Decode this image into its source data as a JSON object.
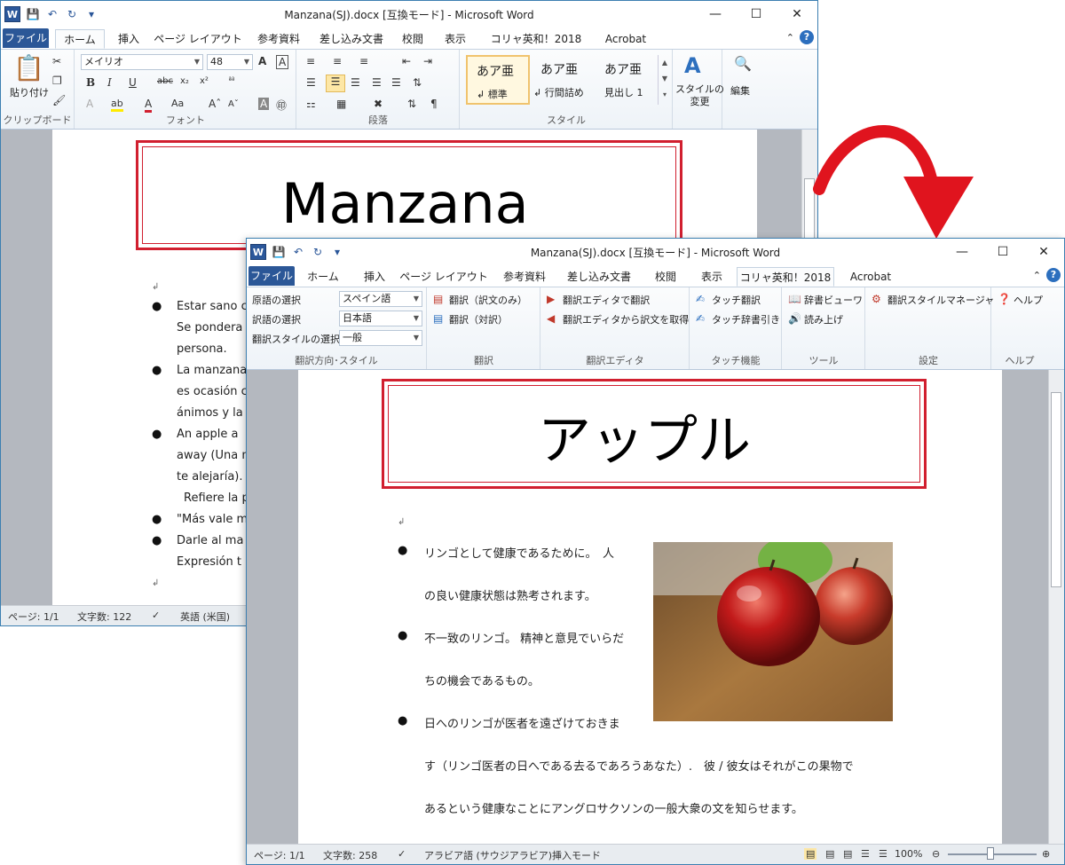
{
  "back_window": {
    "title": "Manzana(SJ).docx [互換モード] - Microsoft Word",
    "tabs": [
      "ファイル",
      "ホーム",
      "挿入",
      "ページ レイアウト",
      "参考資料",
      "差し込み文書",
      "校閲",
      "表示",
      "コリャ英和！2018",
      "Acrobat"
    ],
    "ribbon": {
      "clipboard": {
        "paste": "貼り付け",
        "label": "クリップボード"
      },
      "font": {
        "name": "メイリオ",
        "size": "48",
        "label": "フォント"
      },
      "paragraph": {
        "label": "段落"
      },
      "styles": {
        "items": [
          {
            "sample": "あア亜",
            "name": "↲ 標準"
          },
          {
            "sample": "あア亜",
            "name": "↲ 行間詰め"
          },
          {
            "sample": "あア亜",
            "name": "見出し 1"
          }
        ],
        "change": "スタイルの\n変更",
        "label": "スタイル"
      },
      "edit": {
        "label": "編集"
      }
    },
    "doc": {
      "heading": "Manzana",
      "lines": [
        "Estar sano c",
        "Se pondera",
        "persona.",
        "La manzana",
        "es ocasión c",
        "ánimos y la",
        "An apple a",
        "away (Una m",
        "te alejaría).",
        "Refiere la p",
        "\"Más vale m",
        "Darle al ma",
        "Expresión t"
      ]
    },
    "status": {
      "page": "ページ: 1/1",
      "words": "文字数: 122",
      "lang": "英語 (米国)"
    }
  },
  "front_window": {
    "title": "Manzana(SJ).docx [互換モード] - Microsoft Word",
    "tabs": [
      "ファイル",
      "ホーム",
      "挿入",
      "ページ レイアウト",
      "参考資料",
      "差し込み文書",
      "校閲",
      "表示",
      "コリャ英和！2018",
      "Acrobat"
    ],
    "ribbon": {
      "direction": {
        "source_label": "原語の選択",
        "source_value": "スペイン語",
        "target_label": "訳語の選択",
        "target_value": "日本語",
        "style_label": "翻訳スタイルの選択",
        "style_value": "一般",
        "label": "翻訳方向･スタイル"
      },
      "translate": {
        "only": "翻訳（訳文のみ）",
        "pair": "翻訳（対訳）",
        "label": "翻訳"
      },
      "editor": {
        "translate": "翻訳エディタで翻訳",
        "get": "翻訳エディタから訳文を取得",
        "label": "翻訳エディタ"
      },
      "touch": {
        "translate": "タッチ翻訳",
        "dict": "タッチ辞書引き",
        "label": "タッチ機能"
      },
      "tools": {
        "viewer": "辞書ビューワ",
        "read": "読み上げ",
        "label": "ツール"
      },
      "settings": {
        "manager": "翻訳スタイルマネージャ",
        "label": "設定"
      },
      "help": {
        "help": "ヘルプ",
        "label": "ヘルプ"
      }
    },
    "doc": {
      "heading": "アップル",
      "b1a": "リンゴとして健康であるために。　人",
      "b1b": "の良い健康状態は熟考されます。",
      "b2a": "不一致のリンゴ。 精神と意見でいらだ",
      "b2b": "ちの機会であるもの。",
      "b3a": "日へのリンゴが医者を遠ざけておきま",
      "b3b": "す（リンゴ医者の日へである去るであろうあなた）.　彼 / 彼女はそれがこの果物で",
      "b3c": "あるという健康なことにアングロサクソンの一般大衆の文を知らせます。"
    },
    "status": {
      "page": "ページ: 1/1",
      "words": "文字数: 258",
      "lang": "アラビア語 (サウジアラビア)",
      "mode": "挿入モード",
      "zoom": "100%"
    }
  }
}
